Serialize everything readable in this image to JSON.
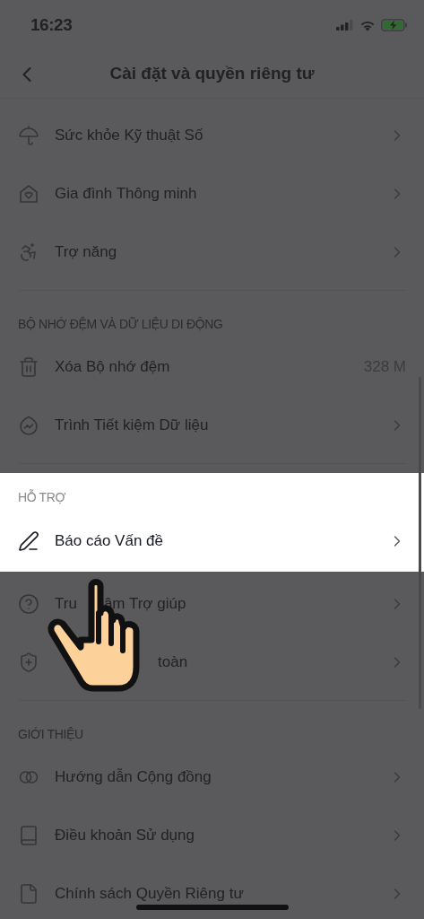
{
  "status_bar": {
    "time": "16:23"
  },
  "header": {
    "title": "Cài đặt và quyền riêng tư"
  },
  "sections": [
    {
      "items": [
        {
          "kind": "link",
          "highlighted": false,
          "parts": [
            "Sức khỏe Kỹ thuật Số"
          ]
        },
        {
          "kind": "link",
          "highlighted": false,
          "parts": [
            "Gia đình Thông minh"
          ]
        },
        {
          "kind": "link",
          "highlighted": false,
          "parts": [
            "Trợ năng"
          ]
        }
      ]
    },
    {
      "title": "BỘ NHỚ ĐỆM VÀ DỮ LIỆU DI ĐỘNG",
      "highlighted": false,
      "items": [
        {
          "kind": "value",
          "highlighted": false,
          "parts": [
            "Xóa Bộ nhớ đệm"
          ],
          "value": "328 M"
        },
        {
          "kind": "link",
          "highlighted": false,
          "parts": [
            "Trình Tiết kiệm Dữ liệu"
          ]
        }
      ]
    },
    {
      "title": "HỖ TRỢ",
      "highlighted": true,
      "items": [
        {
          "kind": "link",
          "highlighted": true,
          "parts": [
            "Báo cáo Vấn đề"
          ]
        },
        {
          "kind": "link",
          "highlighted": false,
          "parts": [
            "Tru",
            "âm Trợ giúp"
          ]
        },
        {
          "kind": "link",
          "highlighted": false,
          "parts": [
            "toàn"
          ]
        }
      ]
    },
    {
      "title": "GIỚI THIỆU",
      "highlighted": false,
      "items": [
        {
          "kind": "link",
          "highlighted": false,
          "parts": [
            "Hướng dẫn Cộng đồng"
          ]
        },
        {
          "kind": "link",
          "highlighted": false,
          "parts": [
            "Điều khoản Sử dụng"
          ]
        },
        {
          "kind": "link",
          "highlighted": false,
          "parts": [
            "Chính sách Quyền Riêng tư"
          ]
        }
      ]
    }
  ]
}
